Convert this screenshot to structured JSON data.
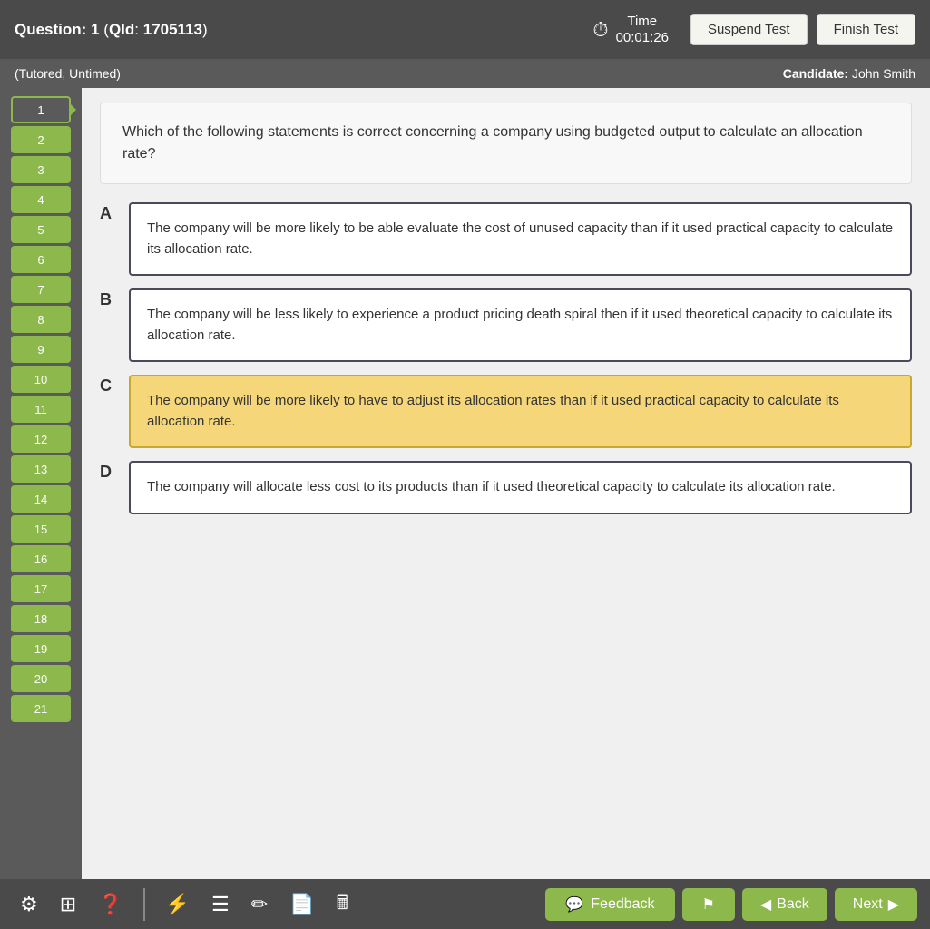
{
  "header": {
    "question_label": "Question:",
    "question_num": "1",
    "qld_label": "Qld",
    "qld_id": "1705113",
    "time_label": "Time",
    "time_value": "00:01:26",
    "suspend_btn": "Suspend Test",
    "finish_btn": "Finish Test"
  },
  "subheader": {
    "mode": "(Tutored, Untimed)",
    "candidate_label": "Candidate:",
    "candidate_name": "John Smith"
  },
  "sidebar": {
    "items": [
      1,
      2,
      3,
      4,
      5,
      6,
      7,
      8,
      9,
      10,
      11,
      12,
      13,
      14,
      15,
      16,
      17,
      18,
      19,
      20,
      21
    ]
  },
  "question": {
    "text": "Which of the following statements is correct concerning a company using budgeted output to calculate an allocation rate?"
  },
  "answers": [
    {
      "letter": "A",
      "text": "The company will be more likely to be able evaluate the cost of unused capacity than if it used practical capacity to calculate its allocation rate.",
      "selected": false
    },
    {
      "letter": "B",
      "text": "The company will be less likely to experience a product pricing death spiral then if it used theoretical capacity to calculate its allocation rate.",
      "selected": false
    },
    {
      "letter": "C",
      "text": "The company will be more likely to have to adjust its allocation rates than if it used practical capacity to calculate its allocation rate.",
      "selected": true
    },
    {
      "letter": "D",
      "text": "The company will allocate less cost to its products than if it used theoretical capacity to calculate its allocation rate.",
      "selected": false
    }
  ],
  "footer": {
    "icons": [
      "gear",
      "grid",
      "help",
      "bolt",
      "list",
      "edit",
      "file",
      "calculator"
    ],
    "feedback_btn": "Feedback",
    "back_btn": "◀ Back",
    "next_btn": "Next ▶"
  }
}
